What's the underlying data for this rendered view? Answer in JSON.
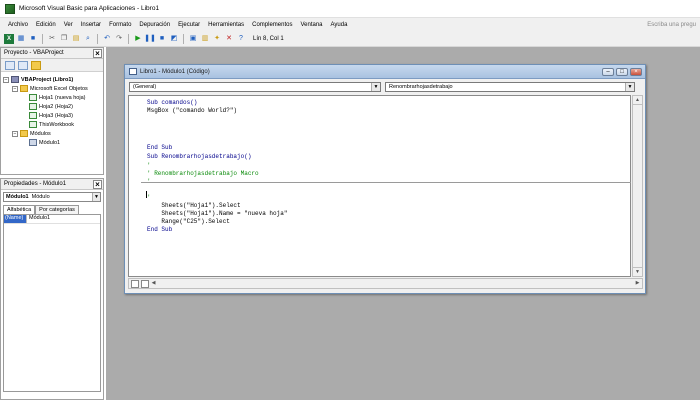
{
  "app": {
    "title": "Microsoft Visual Basic para Aplicaciones - Libro1"
  },
  "menu": {
    "items": [
      "Archivo",
      "Edición",
      "Ver",
      "Insertar",
      "Formato",
      "Depuración",
      "Ejecutar",
      "Herramientas",
      "Complementos",
      "Ventana",
      "Ayuda"
    ],
    "help_placeholder": "Escriba una pregu"
  },
  "toolbar": {
    "icons": [
      "excel-icon",
      "insert-userform-icon",
      "save-icon",
      "cut-icon",
      "copy-icon",
      "paste-icon",
      "find-icon",
      "undo-icon",
      "redo-icon",
      "run-icon",
      "break-icon",
      "reset-icon",
      "design-mode-icon",
      "project-explorer-icon",
      "properties-window-icon",
      "object-browser-icon",
      "toolbox-icon",
      "help-icon"
    ],
    "cursor_position": "Lín 8, Col 1"
  },
  "project_panel": {
    "title": "Proyecto - VBAProject",
    "tree": [
      {
        "label": "VBAProject (Libro1)",
        "icon": "vba-project-icon",
        "level": 0,
        "expander": "−",
        "bold": true
      },
      {
        "label": "Microsoft Excel Objetos",
        "icon": "folder-icon",
        "level": 1,
        "expander": "−",
        "bold": false
      },
      {
        "label": "Hoja1 (nueva hoja)",
        "icon": "sheet-icon",
        "level": 2,
        "expander": "",
        "bold": false
      },
      {
        "label": "Hoja2 (Hoja2)",
        "icon": "sheet-icon",
        "level": 2,
        "expander": "",
        "bold": false
      },
      {
        "label": "Hoja3 (Hoja3)",
        "icon": "sheet-icon",
        "level": 2,
        "expander": "",
        "bold": false
      },
      {
        "label": "ThisWorkbook",
        "icon": "workbook-icon",
        "level": 2,
        "expander": "",
        "bold": false
      },
      {
        "label": "Módulos",
        "icon": "folder-icon",
        "level": 1,
        "expander": "−",
        "bold": false
      },
      {
        "label": "Módulo1",
        "icon": "module-icon",
        "level": 2,
        "expander": "",
        "bold": false
      }
    ]
  },
  "properties_panel": {
    "title": "Propiedades - Módulo1",
    "object_name": "Módulo1",
    "object_type": "Módulo",
    "tabs": [
      "Alfabética",
      "Por categorías"
    ],
    "rows": [
      {
        "key": "(Name)",
        "value": "Módulo1"
      }
    ]
  },
  "code_window": {
    "title": "Libro1 - Módulo1 (Código)",
    "object_combo": "(General)",
    "procedure_combo": "Renombrarhojasdetrabajo",
    "lines": [
      {
        "text": "Sub comandos()",
        "style": "kw"
      },
      {
        "text": "MsgBox (\"comando World?\")",
        "style": "plain"
      },
      {
        "text": "",
        "style": "plain"
      },
      {
        "text": "",
        "style": "plain"
      },
      {
        "text": "",
        "style": "plain"
      },
      {
        "text": "End Sub",
        "style": "kw"
      },
      {
        "text": "Sub Renombrarhojasdetrabajo()",
        "style": "kw"
      },
      {
        "text": "'",
        "style": "cm"
      },
      {
        "text": "' Renombrarhojasdetrabajo Macro",
        "style": "cm"
      },
      {
        "text": "'",
        "style": "cm"
      },
      {
        "text": "",
        "style": "plain"
      },
      {
        "text": "'",
        "style": "cm"
      },
      {
        "text": "    Sheets(\"Hoja1\").Select",
        "style": "plain"
      },
      {
        "text": "    Sheets(\"Hoja1\").Name = \"nueva hoja\"",
        "style": "plain"
      },
      {
        "text": "    Range(\"C25\").Select",
        "style": "plain"
      },
      {
        "text": "End Sub",
        "style": "kw"
      }
    ]
  }
}
